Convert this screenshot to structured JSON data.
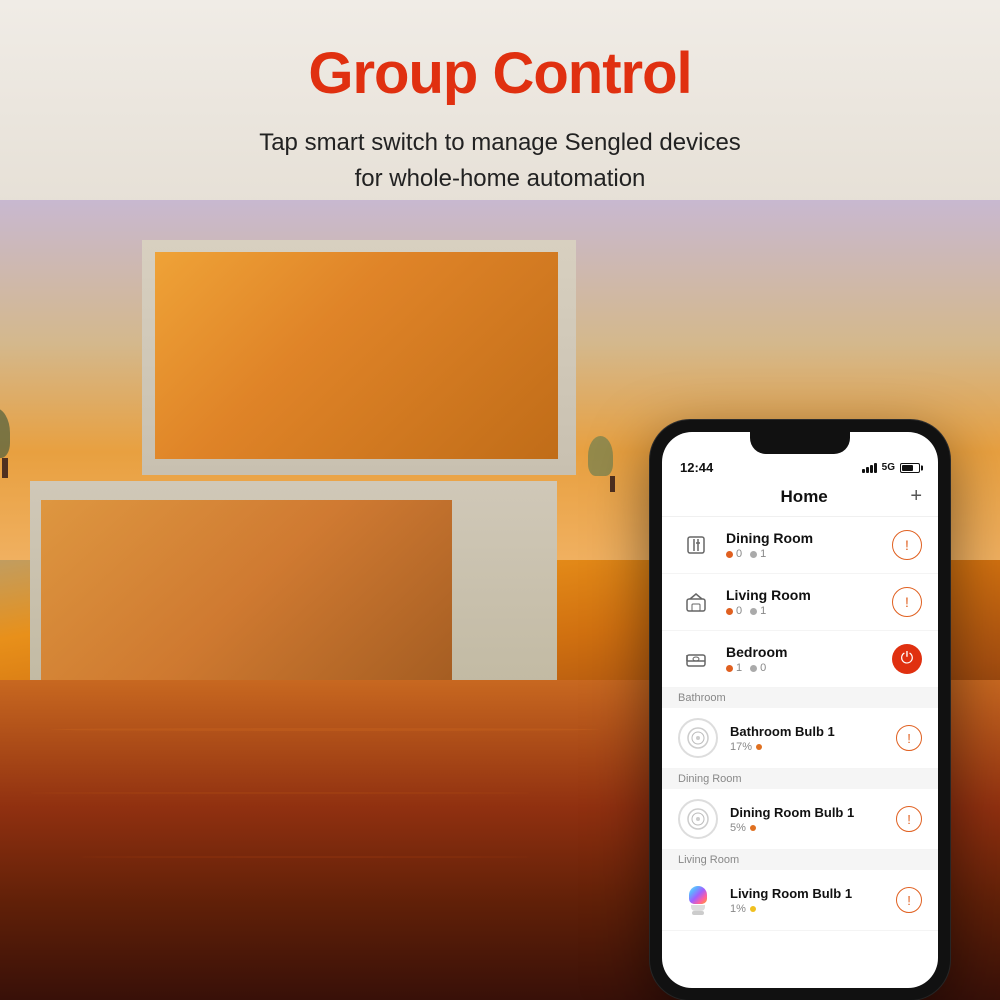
{
  "page": {
    "background_color": "#e8e0d8"
  },
  "header": {
    "title": "Group Control",
    "subtitle_line1": "Tap smart switch to manage Sengled devices",
    "subtitle_line2": "for whole-home automation"
  },
  "phone": {
    "status_bar": {
      "time": "12:44",
      "network": "5G",
      "battery_level": "70"
    },
    "app_header": {
      "title": "Home",
      "add_button": "+"
    },
    "rooms": [
      {
        "id": "dining-room",
        "name": "Dining Room",
        "icon": "dining",
        "stat_offline": "0",
        "stat_online": "1",
        "action": "warning"
      },
      {
        "id": "living-room",
        "name": "Living Room",
        "icon": "living",
        "stat_offline": "0",
        "stat_online": "1",
        "action": "warning"
      },
      {
        "id": "bedroom",
        "name": "Bedroom",
        "icon": "bedroom",
        "stat_offline": "1",
        "stat_online": "0",
        "action": "power-on"
      }
    ],
    "sections": [
      {
        "label": "Bathroom",
        "devices": [
          {
            "name": "Bathroom Bulb 1",
            "brightness": "17%",
            "status_dot": "orange",
            "action": "warning",
            "icon_type": "circle-bulb"
          }
        ]
      },
      {
        "label": "Dining Room",
        "devices": [
          {
            "name": "Dining Room Bulb 1",
            "brightness": "5%",
            "status_dot": "orange",
            "action": "warning",
            "icon_type": "circle-bulb"
          }
        ]
      },
      {
        "label": "Living Room",
        "devices": [
          {
            "name": "Living Room Bulb 1",
            "brightness": "1%",
            "status_dot": "yellow",
            "action": "warning",
            "icon_type": "color-bulb"
          }
        ]
      }
    ]
  }
}
